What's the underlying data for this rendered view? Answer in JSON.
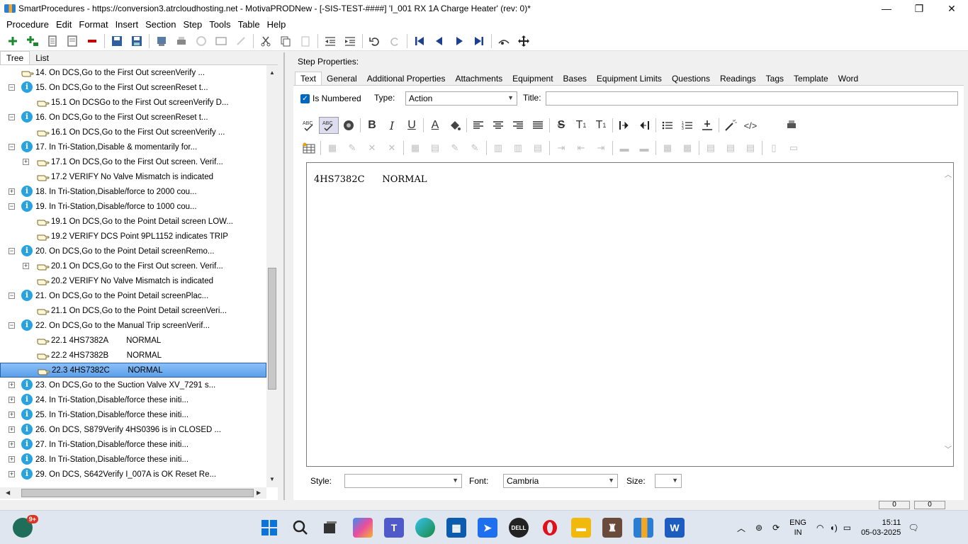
{
  "window": {
    "title": "SmartProcedures - https://conversion3.atrcloudhosting.net - MotivaPRODNew - [-SIS-TEST-####] 'I_001 RX 1A Charge Heater' (rev: 0)*",
    "minimize": "—",
    "maximize": "❐",
    "close": "✕"
  },
  "menu": [
    "Procedure",
    "Edit",
    "Format",
    "Insert",
    "Section",
    "Step",
    "Tools",
    "Table",
    "Help"
  ],
  "left_tabs": [
    "Tree",
    "List"
  ],
  "tree": [
    {
      "exp": "",
      "icon": "hand",
      "indent": 0,
      "text": "14. On DCS,Go to the First Out screenVerify ..."
    },
    {
      "exp": "−",
      "icon": "info",
      "indent": 0,
      "text": "15. On DCS,Go to the First Out screenReset t..."
    },
    {
      "exp": "",
      "icon": "hand",
      "indent": 1,
      "text": "15.1 On DCSGo to the First Out screenVerify D..."
    },
    {
      "exp": "−",
      "icon": "info",
      "indent": 0,
      "text": "16. On DCS,Go to the First Out screenReset t..."
    },
    {
      "exp": "",
      "icon": "hand",
      "indent": 1,
      "text": "16.1 On DCS,Go to the First Out screenVerify ..."
    },
    {
      "exp": "−",
      "icon": "info",
      "indent": 0,
      "text": "17. In Tri-Station,Disable & momentarily for..."
    },
    {
      "exp": "+",
      "icon": "hand",
      "indent": 1,
      "text": "17.1 On DCS,Go to the First Out screen. Verif..."
    },
    {
      "exp": "",
      "icon": "hand",
      "indent": 1,
      "text": "17.2 VERIFY No Valve Mismatch is indicated"
    },
    {
      "exp": "+",
      "icon": "info",
      "indent": 0,
      "text": "18. In Tri-Station,Disable/force to 2000 cou..."
    },
    {
      "exp": "−",
      "icon": "info",
      "indent": 0,
      "text": "19. In Tri-Station,Disable/force to 1000 cou..."
    },
    {
      "exp": "",
      "icon": "hand",
      "indent": 1,
      "text": "19.1 On DCS,Go to the Point Detail screen LOW..."
    },
    {
      "exp": "",
      "icon": "hand",
      "indent": 1,
      "text": "19.2 VERIFY DCS Point 9PL1152 indicates TRIP"
    },
    {
      "exp": "−",
      "icon": "info",
      "indent": 0,
      "text": "20. On DCS,Go to the Point Detail screenRemo..."
    },
    {
      "exp": "+",
      "icon": "hand",
      "indent": 1,
      "text": "20.1 On DCS,Go to the First Out screen. Verif..."
    },
    {
      "exp": "",
      "icon": "hand",
      "indent": 1,
      "text": "20.2 VERIFY No Valve Mismatch is indicated"
    },
    {
      "exp": "−",
      "icon": "info",
      "indent": 0,
      "text": "21. On DCS,Go to the Point Detail screenPlac..."
    },
    {
      "exp": "",
      "icon": "hand",
      "indent": 1,
      "text": "21.1 On DCS,Go to the Point Detail screenVeri..."
    },
    {
      "exp": "−",
      "icon": "info",
      "indent": 0,
      "text": "22. On DCS,Go to the Manual Trip screenVerif..."
    },
    {
      "exp": "",
      "icon": "hand",
      "indent": 1,
      "text": "22.1 4HS7382A        NORMAL"
    },
    {
      "exp": "",
      "icon": "hand",
      "indent": 1,
      "text": "22.2 4HS7382B        NORMAL"
    },
    {
      "exp": "",
      "icon": "hand",
      "indent": 1,
      "text": "22.3 4HS7382C        NORMAL",
      "selected": true
    },
    {
      "exp": "+",
      "icon": "info",
      "indent": 0,
      "text": "23. On DCS,Go to the Suction Valve XV_7291 s..."
    },
    {
      "exp": "+",
      "icon": "info",
      "indent": 0,
      "text": "24. In Tri-Station,Disable/force these initi..."
    },
    {
      "exp": "+",
      "icon": "info",
      "indent": 0,
      "text": "25. In Tri-Station,Disable/force these initi..."
    },
    {
      "exp": "+",
      "icon": "info",
      "indent": 0,
      "text": "26. On DCS, S879Verify 4HS0396 is in CLOSED ..."
    },
    {
      "exp": "+",
      "icon": "info",
      "indent": 0,
      "text": "27. In Tri-Station,Disable/force these initi..."
    },
    {
      "exp": "+",
      "icon": "info",
      "indent": 0,
      "text": "28. In Tri-Station,Disable/force these initi..."
    },
    {
      "exp": "+",
      "icon": "info",
      "indent": 0,
      "text": "29. On DCS, S642Verify I_007A is OK Reset Re..."
    }
  ],
  "step_properties": {
    "heading": "Step Properties:",
    "tabs": [
      "Text",
      "General",
      "Additional Properties",
      "Attachments",
      "Equipment",
      "Bases",
      "Equipment Limits",
      "Questions",
      "Readings",
      "Tags",
      "Template",
      "Word"
    ],
    "is_numbered_label": "Is Numbered",
    "type_label": "Type:",
    "type_value": "Action",
    "title_label": "Title:",
    "title_value": "",
    "editor_text": "4HS7382C      NORMAL",
    "style_label": "Style:",
    "style_value": "",
    "font_label": "Font:",
    "font_value": "Cambria",
    "size_label": "Size:",
    "size_value": ""
  },
  "status": {
    "box1": "0",
    "box2": "0"
  },
  "taskbar": {
    "badge": "9+",
    "lang1": "ENG",
    "lang2": "IN",
    "time": "15:11",
    "date": "05-03-2025"
  },
  "colors": {
    "accent": "#0067c0",
    "info_icon": "#29a3e0",
    "selected_row": "#5b9fe8"
  }
}
